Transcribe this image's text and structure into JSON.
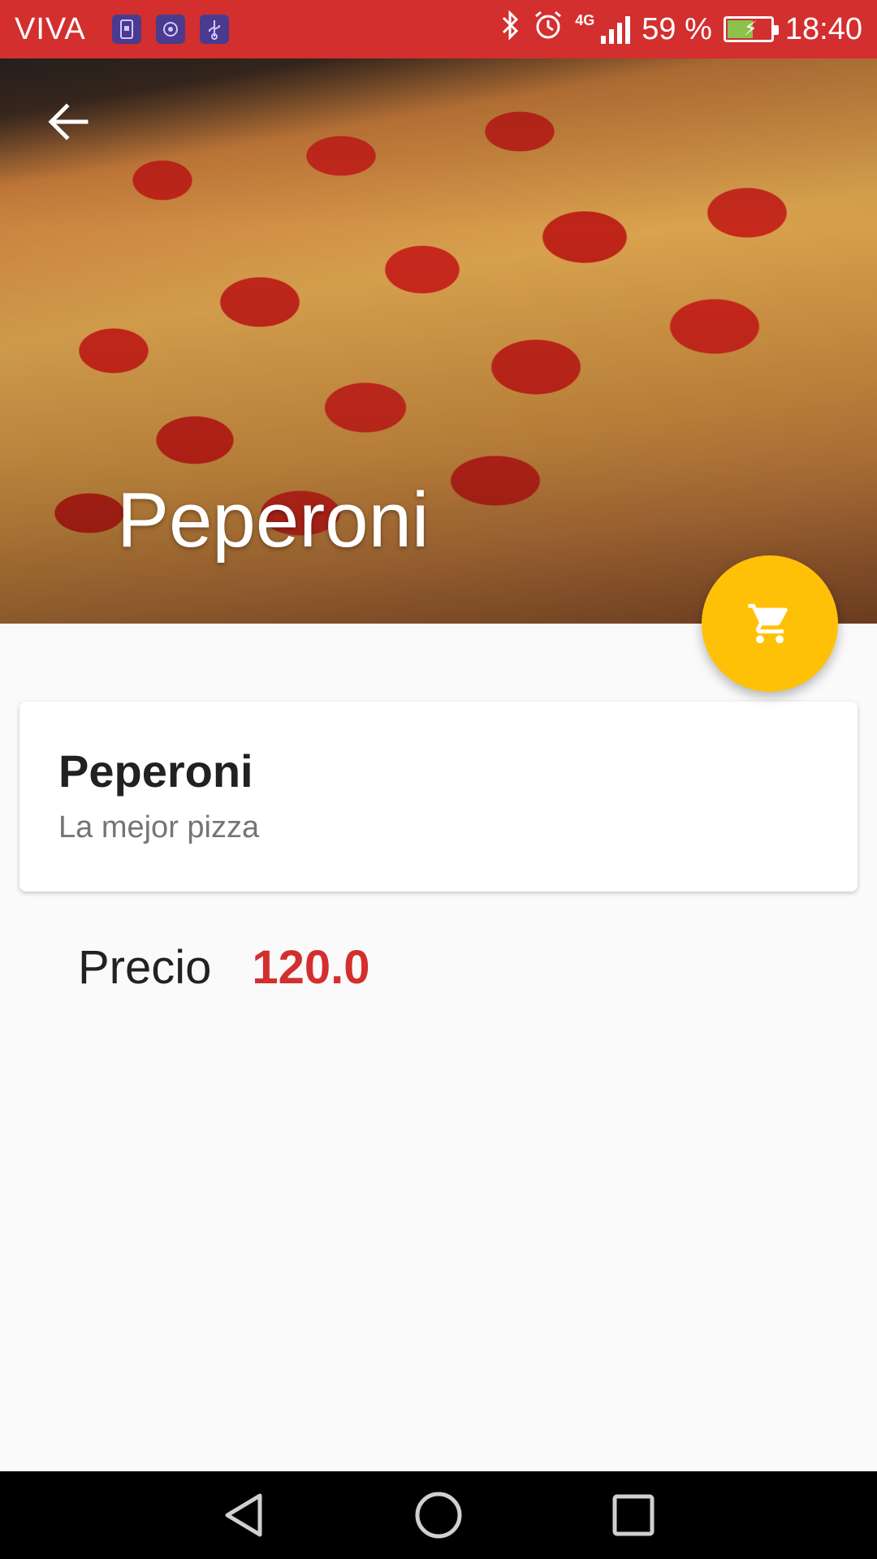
{
  "status_bar": {
    "carrier": "VIVA",
    "network": "4G",
    "battery": "59 %",
    "battery_level": 0.59,
    "time": "18:40",
    "notification_icons": [
      "phone-sync-icon",
      "app-sync-icon",
      "usb-icon"
    ],
    "status_icons": [
      "bluetooth-icon",
      "alarm-icon",
      "signal-icon",
      "battery-icon"
    ]
  },
  "header": {
    "title": "Peperoni",
    "back_icon": "arrow-back-icon"
  },
  "fab": {
    "icon": "cart-icon",
    "color": "#ffc107"
  },
  "card": {
    "title": "Peperoni",
    "subtitle": "La mejor pizza"
  },
  "price": {
    "label": "Precio",
    "value": "120.0",
    "value_color": "#d32f2f"
  },
  "colors": {
    "primary": "#d32f2f",
    "accent": "#ffc107"
  },
  "nav_bar": {
    "icons": [
      "nav-back-icon",
      "nav-home-icon",
      "nav-recents-icon"
    ]
  }
}
